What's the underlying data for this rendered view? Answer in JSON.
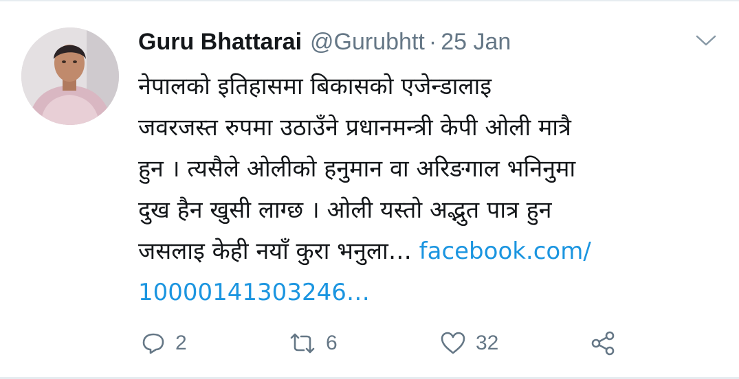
{
  "tweet": {
    "author_name": "Guru Bhattarai",
    "handle": "@Gurubhtt",
    "separator": "·",
    "date": "25 Jan",
    "text_lines": [
      "नेपालको इतिहासमा बिकासको एजेन्डालाइ",
      "जवरजस्त रुपमा उठाउँने प्रधानमन्त्री केपी ओली मात्रै",
      "हुन । त्यसैले ओलीको हनुमान वा अरिङगाल भनिनुमा",
      "दुख हैन खुसी लाग्छ । ओली यस्तो अद्भुत पात्र हुन",
      "जसलाइ केही नयाँ कुरा भनुला…"
    ],
    "link_part1": "facebook.com/",
    "link_part2": "10000141303246…"
  },
  "actions": {
    "reply_count": "2",
    "retweet_count": "6",
    "like_count": "32"
  },
  "icons": {
    "menu": "chevron-down-icon",
    "reply": "reply-icon",
    "retweet": "retweet-icon",
    "like": "heart-icon",
    "share": "share-icon"
  },
  "colors": {
    "text": "#14171a",
    "secondary": "#657786",
    "link": "#1b95e0",
    "border": "#e6ecf0"
  }
}
